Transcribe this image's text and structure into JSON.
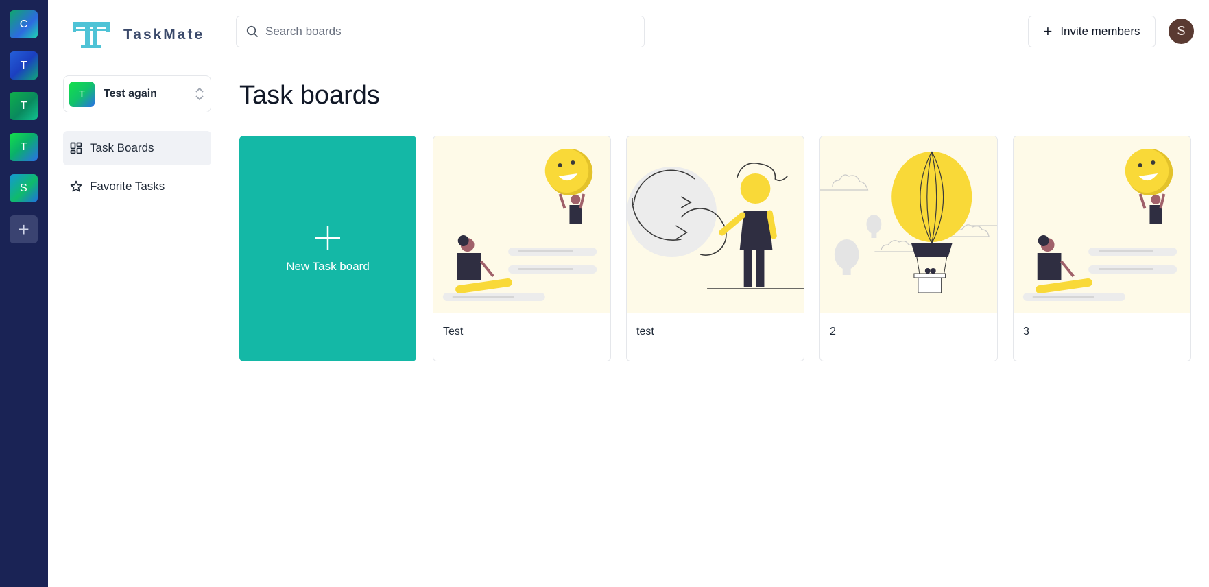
{
  "org_rail": {
    "items": [
      {
        "initial": "C"
      },
      {
        "initial": "T"
      },
      {
        "initial": "T"
      },
      {
        "initial": "T"
      },
      {
        "initial": "S"
      }
    ],
    "add_label": "+"
  },
  "app": {
    "name": "TaskMate",
    "brand_color": "#4fc3d6"
  },
  "org_switcher": {
    "initial": "T",
    "name": "Test again"
  },
  "nav": {
    "items": [
      {
        "label": "Task Boards",
        "icon": "dashboard-icon",
        "active": true
      },
      {
        "label": "Favorite Tasks",
        "icon": "star-icon",
        "active": false
      }
    ]
  },
  "header": {
    "search_placeholder": "Search boards",
    "invite_label": "Invite members",
    "user_initial": "S"
  },
  "main": {
    "title": "Task boards",
    "new_board_label": "New Task board",
    "boards": [
      {
        "title": "Test",
        "illustration": "smiley-climb"
      },
      {
        "title": "test",
        "illustration": "refresh-person"
      },
      {
        "title": "2",
        "illustration": "hot-air-balloon"
      },
      {
        "title": "3",
        "illustration": "smiley-climb"
      }
    ]
  },
  "colors": {
    "rail": "#1a2355",
    "accent": "#14b8a6",
    "illustration_bg": "#fefae8",
    "illustration_yellow": "#f9d938"
  }
}
